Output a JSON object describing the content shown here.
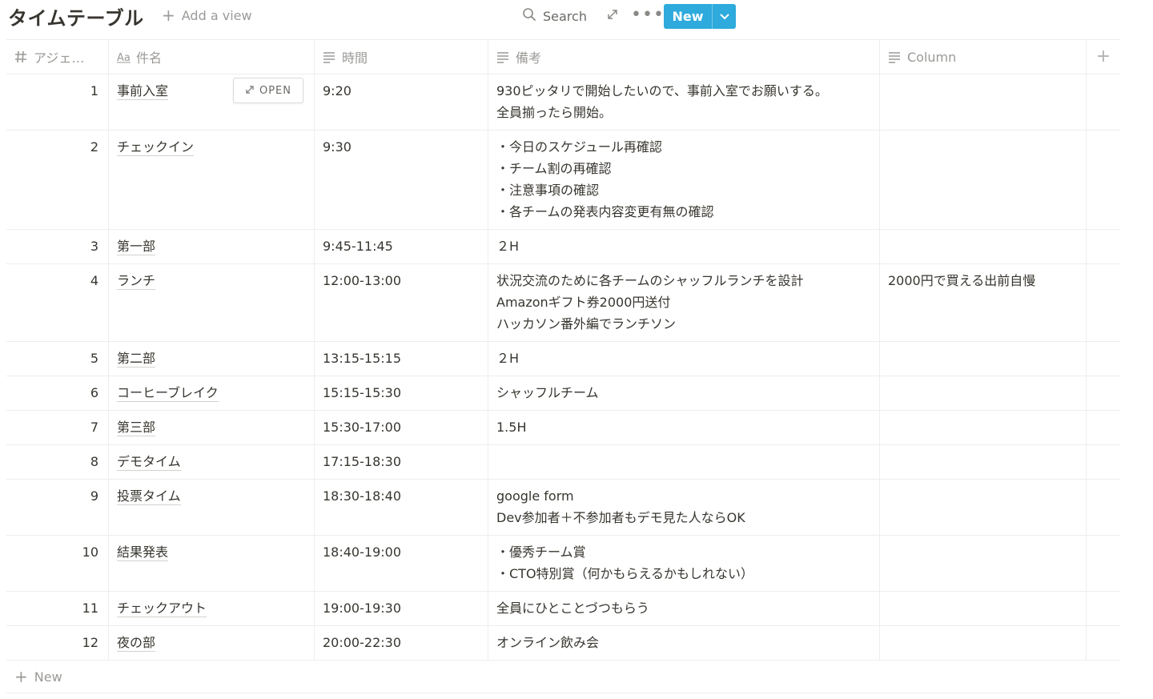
{
  "page": {
    "title": "タイムテーブル",
    "add_view_label": "Add a view"
  },
  "toolbar": {
    "search_label": "Search",
    "new_label": "New"
  },
  "columns": [
    {
      "label": "アジェ…",
      "icon": "hash-icon"
    },
    {
      "label": "件名",
      "icon": "title-aa-icon"
    },
    {
      "label": "時間",
      "icon": "text-lines-icon"
    },
    {
      "label": "備考",
      "icon": "text-lines-icon"
    },
    {
      "label": "Column",
      "icon": "text-lines-icon"
    }
  ],
  "row_action": {
    "open_label": "OPEN"
  },
  "rows": [
    {
      "no": "1",
      "title": "事前入室",
      "time": "9:20",
      "notes": [
        "930ピッタリで開始したいので、事前入室でお願いする。",
        "全員揃ったら開始。"
      ],
      "column": ""
    },
    {
      "no": "2",
      "title": "チェックイン",
      "time": "9:30",
      "notes": [
        "・今日のスケジュール再確認",
        "・チーム割の再確認",
        "・注意事項の確認",
        "・各チームの発表内容変更有無の確認"
      ],
      "column": ""
    },
    {
      "no": "3",
      "title": "第一部",
      "time": "9:45-11:45",
      "notes": [
        "２H"
      ],
      "column": ""
    },
    {
      "no": "4",
      "title": "ランチ",
      "time": "12:00-13:00",
      "notes": [
        "状況交流のために各チームのシャッフルランチを設計",
        "Amazonギフト券2000円送付",
        "ハッカソン番外編でランチソン"
      ],
      "column": "2000円で買える出前自慢"
    },
    {
      "no": "5",
      "title": "第二部",
      "time": "13:15-15:15",
      "notes": [
        "２H"
      ],
      "column": ""
    },
    {
      "no": "6",
      "title": "コーヒーブレイク",
      "time": "15:15-15:30",
      "notes": [
        "シャッフルチーム"
      ],
      "column": ""
    },
    {
      "no": "7",
      "title": "第三部",
      "time": "15:30-17:00",
      "notes": [
        "1.5H"
      ],
      "column": ""
    },
    {
      "no": "8",
      "title": "デモタイム",
      "time": "17:15-18:30",
      "notes": [],
      "column": ""
    },
    {
      "no": "9",
      "title": "投票タイム",
      "time": "18:30-18:40",
      "notes": [
        "google form",
        "Dev参加者＋不参加者もデモ見た人ならOK"
      ],
      "column": ""
    },
    {
      "no": "10",
      "title": "結果発表",
      "time": "18:40-19:00",
      "notes": [
        "・優秀チーム賞",
        "・CTO特別賞（何かもらえるかもしれない）"
      ],
      "column": ""
    },
    {
      "no": "11",
      "title": "チェックアウト",
      "time": "19:00-19:30",
      "notes": [
        "全員にひとことづつもらう"
      ],
      "column": ""
    },
    {
      "no": "12",
      "title": "夜の部",
      "time": "20:00-22:30",
      "notes": [
        "オンライン飲み会"
      ],
      "column": ""
    }
  ],
  "footer": {
    "new_row_label": "New"
  },
  "colors": {
    "accent": "#2eaadc",
    "text": "#37352f",
    "muted": "#9b9a97",
    "border": "#ededec"
  }
}
